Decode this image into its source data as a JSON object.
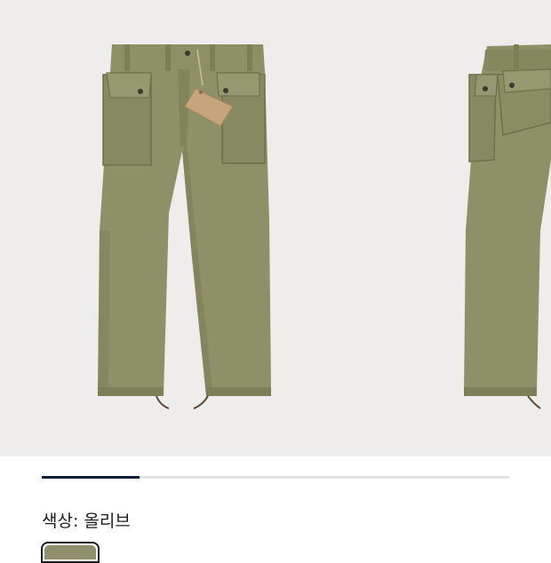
{
  "gallery": {
    "images": [
      {
        "icon": "olive-pants-front-image"
      },
      {
        "icon": "olive-pants-side-image"
      }
    ],
    "progress": 0.21
  },
  "color": {
    "label": "색상:",
    "value": "올리브",
    "swatch_color": "#8f8f6e"
  },
  "colors": {
    "accent": "#0c1f3a",
    "background": "#eeedec",
    "fabric": "#8f9168"
  }
}
